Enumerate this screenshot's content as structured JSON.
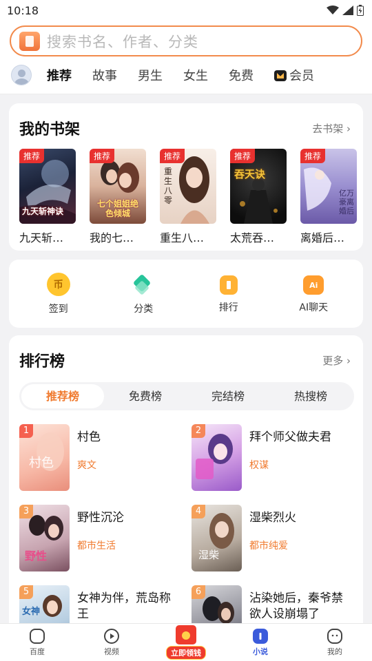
{
  "status": {
    "time": "10:18"
  },
  "search": {
    "placeholder": "搜索书名、作者、分类"
  },
  "nav": {
    "tabs": [
      {
        "label": "推荐",
        "active": true
      },
      {
        "label": "故事"
      },
      {
        "label": "男生"
      },
      {
        "label": "女生"
      },
      {
        "label": "免费"
      },
      {
        "label": "会员"
      }
    ]
  },
  "shelf": {
    "title": "我的书架",
    "link": "去书架 ›",
    "badge": "推荐",
    "books": [
      {
        "title": "九天斩…",
        "cover_text": "九天斩神诀"
      },
      {
        "title": "我的七…",
        "cover_text": "七个姐姐绝色倾城"
      },
      {
        "title": "重生八…",
        "cover_text": "重生八零"
      },
      {
        "title": "太荒吞…",
        "cover_text": "吞天诀"
      },
      {
        "title": "离婚后…",
        "cover_text": "亿万豪离婚后"
      }
    ]
  },
  "quick": [
    {
      "label": "签到",
      "icon": "coin-icon",
      "glyph": "币"
    },
    {
      "label": "分类",
      "icon": "layers-icon"
    },
    {
      "label": "排行",
      "icon": "rank-icon"
    },
    {
      "label": "AI聊天",
      "icon": "ai-chat-icon",
      "glyph": "Ai"
    }
  ],
  "rank": {
    "title": "排行榜",
    "link": "更多 ›",
    "tabs": [
      {
        "label": "推荐榜",
        "active": true
      },
      {
        "label": "免费榜"
      },
      {
        "label": "完结榜"
      },
      {
        "label": "热搜榜"
      }
    ],
    "items": [
      {
        "num": "1",
        "title": "村色",
        "tag": "爽文",
        "color": "#f5604f"
      },
      {
        "num": "2",
        "title": "拜个师父做夫君",
        "tag": "权谋",
        "color": "#f5875a"
      },
      {
        "num": "3",
        "title": "野性沉沦",
        "tag": "都市生活",
        "color": "#f5a05a"
      },
      {
        "num": "4",
        "title": "湿柴烈火",
        "tag": "都市纯爱",
        "color": "#f5a05a"
      },
      {
        "num": "5",
        "title": "女神为伴，荒岛称王",
        "tag": "",
        "color": "#f5a05a"
      },
      {
        "num": "6",
        "title": "沾染她后，秦爷禁欲人设崩塌了",
        "tag": "",
        "color": "#f5a05a"
      }
    ]
  },
  "bottom_nav": [
    {
      "label": "百度",
      "icon": "baidu-icon"
    },
    {
      "label": "视频",
      "icon": "video-icon"
    },
    {
      "label": "立即领钱",
      "icon": "red-packet-icon",
      "special": true
    },
    {
      "label": "小说",
      "icon": "novel-icon",
      "active": true
    },
    {
      "label": "我的",
      "icon": "profile-icon"
    }
  ]
}
